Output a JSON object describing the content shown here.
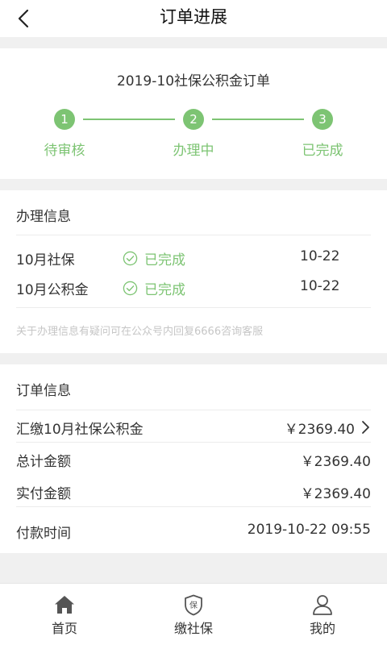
{
  "header": {
    "title": "订单进展"
  },
  "progress": {
    "order_title": "2019-10社保公积金订单",
    "steps": [
      {
        "num": "1",
        "label": "待审核"
      },
      {
        "num": "2",
        "label": "办理中"
      },
      {
        "num": "3",
        "label": "已完成"
      }
    ]
  },
  "handle_info": {
    "title": "办理信息",
    "rows": [
      {
        "name": "10月社保",
        "status": "已完成",
        "date": "10-22"
      },
      {
        "name": "10月公积金",
        "status": "已完成",
        "date": "10-22"
      }
    ],
    "hint": "关于办理信息有疑问可在公众号内回复6666咨询客服"
  },
  "order_info": {
    "title": "订单信息",
    "item_label": "汇缴10月社保公积金",
    "item_amount": "￥2369.40",
    "total_label": "总计金额",
    "total_amount": "￥2369.40",
    "paid_label": "实付金额",
    "paid_amount": "￥2369.40",
    "time_label": "付款时间",
    "time_value": "2019-10-22 09:55"
  },
  "tabbar": {
    "items": [
      {
        "label": "首页",
        "icon": "home-icon"
      },
      {
        "label": "缴社保",
        "icon": "shield-icon",
        "glyph": "保"
      },
      {
        "label": "我的",
        "icon": "user-icon"
      }
    ]
  },
  "colors": {
    "accent": "#7dc473",
    "background": "#f0f0f0"
  }
}
